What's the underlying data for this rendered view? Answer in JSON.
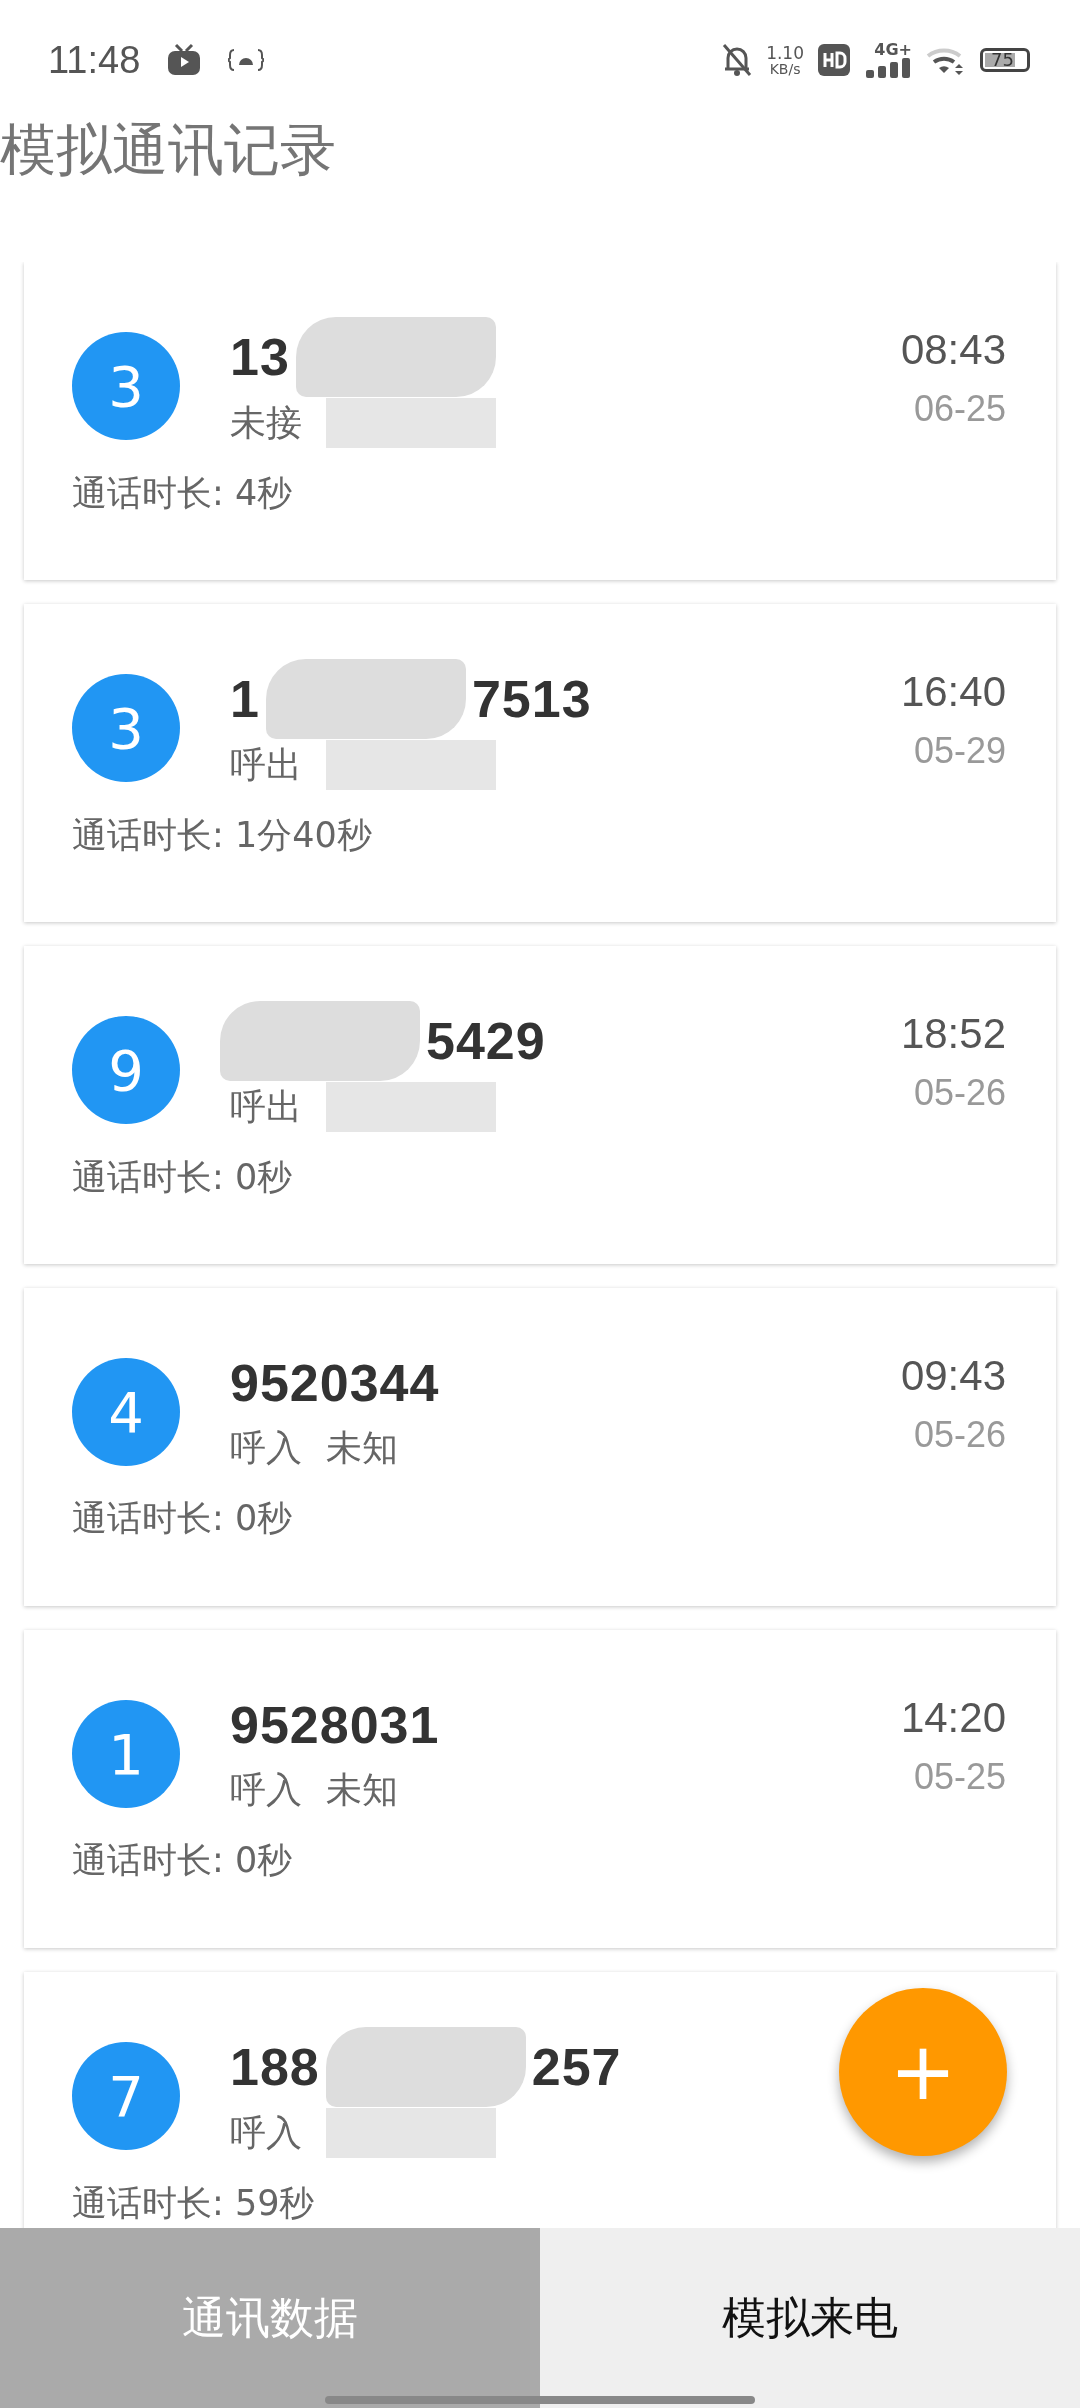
{
  "status_bar": {
    "time": "11:48",
    "net_speed": "1.10",
    "net_unit": "KB/s",
    "network": "4G+",
    "battery": "75"
  },
  "title": "模拟通讯记录",
  "calls": [
    {
      "badge": "3",
      "number": "13",
      "masked": true,
      "type": "未接",
      "time": "08:43",
      "date": "06-25",
      "duration": "通话时长: 4秒"
    },
    {
      "badge": "3",
      "number": "1",
      "number_tail": "7513",
      "masked": true,
      "type": "呼出",
      "time": "16:40",
      "date": "05-29",
      "duration": "通话时长: 1分40秒"
    },
    {
      "badge": "9",
      "number_tail": "5429",
      "masked": true,
      "type": "呼出",
      "time": "18:52",
      "date": "05-26",
      "duration": "通话时长: 0秒"
    },
    {
      "badge": "4",
      "number": "9520344",
      "masked": false,
      "type": "呼入",
      "location": "未知",
      "time": "09:43",
      "date": "05-26",
      "duration": "通话时长: 0秒"
    },
    {
      "badge": "1",
      "number": "9528031",
      "masked": false,
      "type": "呼入",
      "location": "未知",
      "time": "14:20",
      "date": "05-25",
      "duration": "通话时长: 0秒"
    },
    {
      "badge": "7",
      "number": "188",
      "number_tail": "257",
      "masked": true,
      "type": "呼入",
      "duration": "通话时长: 59秒"
    }
  ],
  "fab": {
    "label": "+"
  },
  "tabs": [
    {
      "label": "通讯数据",
      "selected": true
    },
    {
      "label": "模拟来电",
      "selected": false
    }
  ]
}
